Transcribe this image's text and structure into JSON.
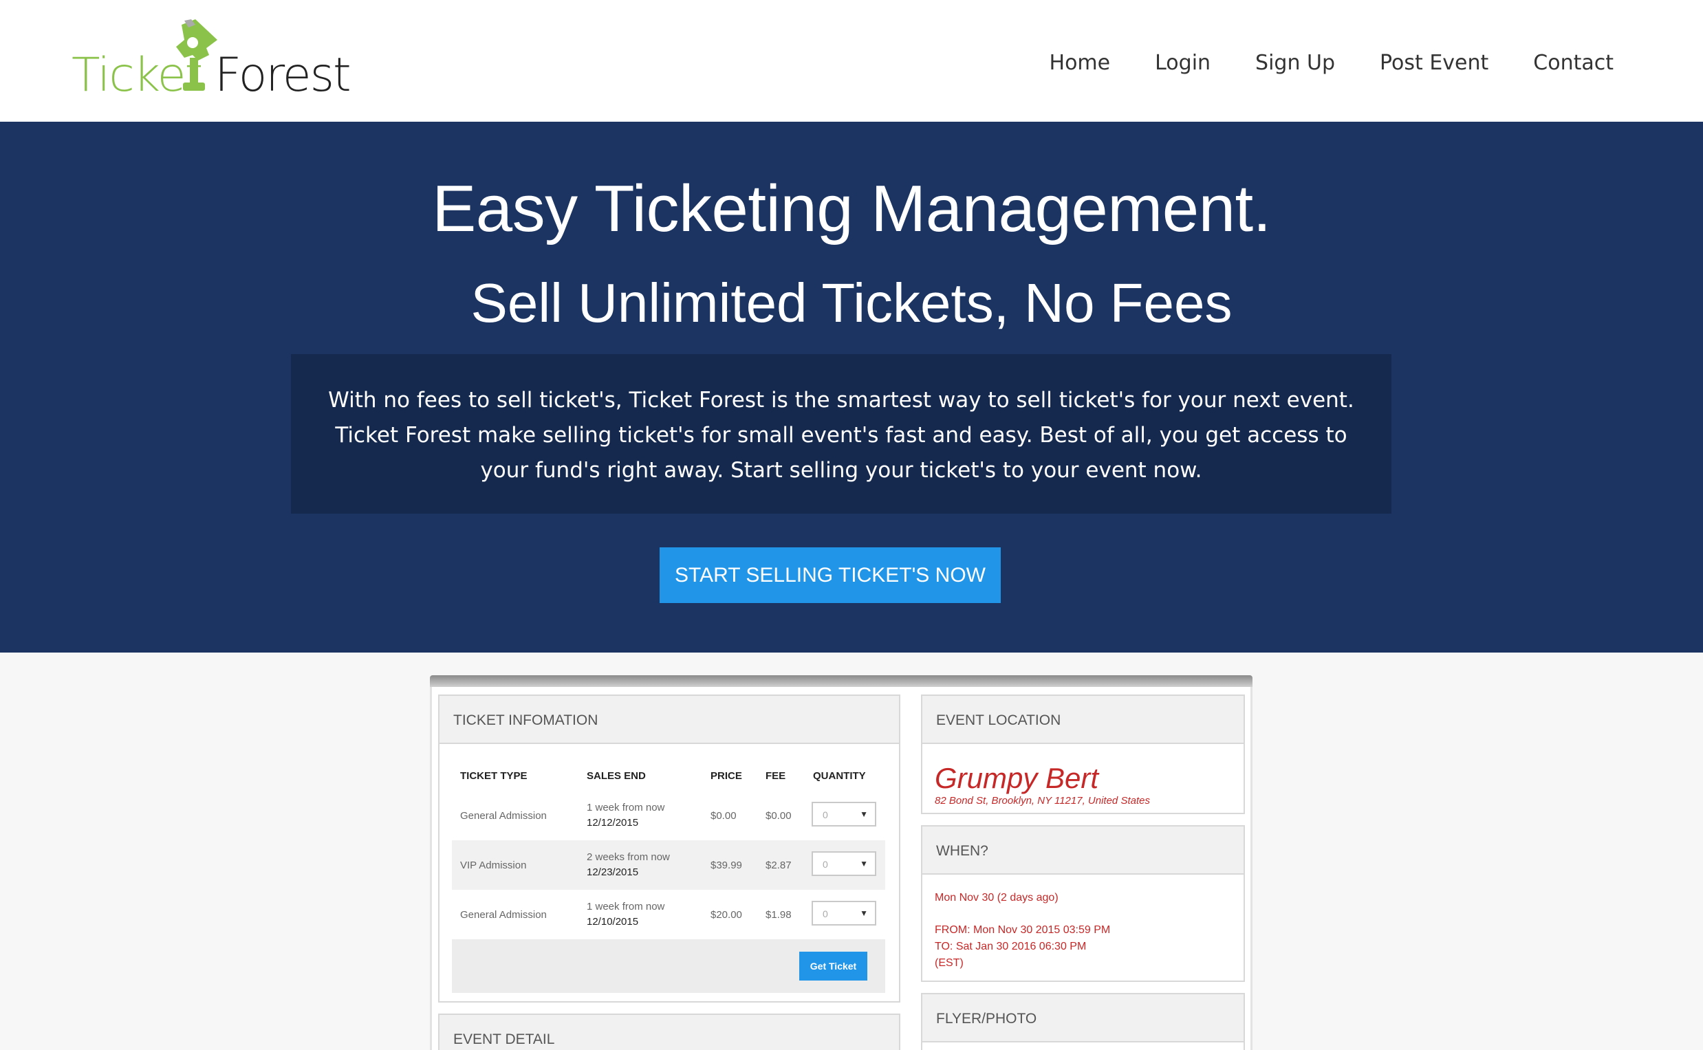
{
  "logo": {
    "word1": "Ticket",
    "word2": "Forest",
    "brand_green": "#8bc34a"
  },
  "nav": {
    "items": [
      "Home",
      "Login",
      "Sign Up",
      "Post Event",
      "Contact"
    ]
  },
  "hero": {
    "title": "Easy Ticketing Management.",
    "subtitle": "Sell Unlimited Tickets, No Fees",
    "description": "With no fees to sell ticket's, Ticket Forest is the smartest way to sell ticket's for your next event. Ticket Forest make selling ticket's for small event's fast and easy. Best of all, you get access to your fund's right away. Start selling your ticket's to your event now.",
    "cta_label": "START SELLING TICKET'S NOW",
    "background": "#1b3461",
    "cta_color": "#2196e8"
  },
  "preview": {
    "ticket_panel": {
      "title": "TICKET INFOMATION",
      "columns": [
        "TICKET TYPE",
        "SALES END",
        "PRICE",
        "FEE",
        "QUANTITY"
      ],
      "rows": [
        {
          "type": "General Admission",
          "relative": "1 week from now",
          "date": "12/12/2015",
          "price": "$0.00",
          "fee": "$0.00",
          "qty": "0"
        },
        {
          "type": "VIP Admission",
          "relative": "2 weeks from now",
          "date": "12/23/2015",
          "price": "$39.99",
          "fee": "$2.87",
          "qty": "0"
        },
        {
          "type": "General Admission",
          "relative": "1 week from now",
          "date": "12/10/2015",
          "price": "$20.00",
          "fee": "$1.98",
          "qty": "0"
        }
      ],
      "button_label": "Get Ticket"
    },
    "detail_panel": {
      "title": "EVENT DETAIL"
    },
    "location_panel": {
      "title": "EVENT LOCATION",
      "venue": "Grumpy Bert",
      "address": "82 Bond St, Brooklyn, NY 11217, United States"
    },
    "when_panel": {
      "title": "WHEN?",
      "line1": "Mon Nov 30 (2 days ago)",
      "from": "FROM: Mon Nov 30 2015 03:59 PM",
      "to": "TO: Sat Jan 30 2016 06:30 PM",
      "tz": "(EST)"
    },
    "flyer_panel": {
      "title": "FLYER/PHOTO"
    }
  }
}
